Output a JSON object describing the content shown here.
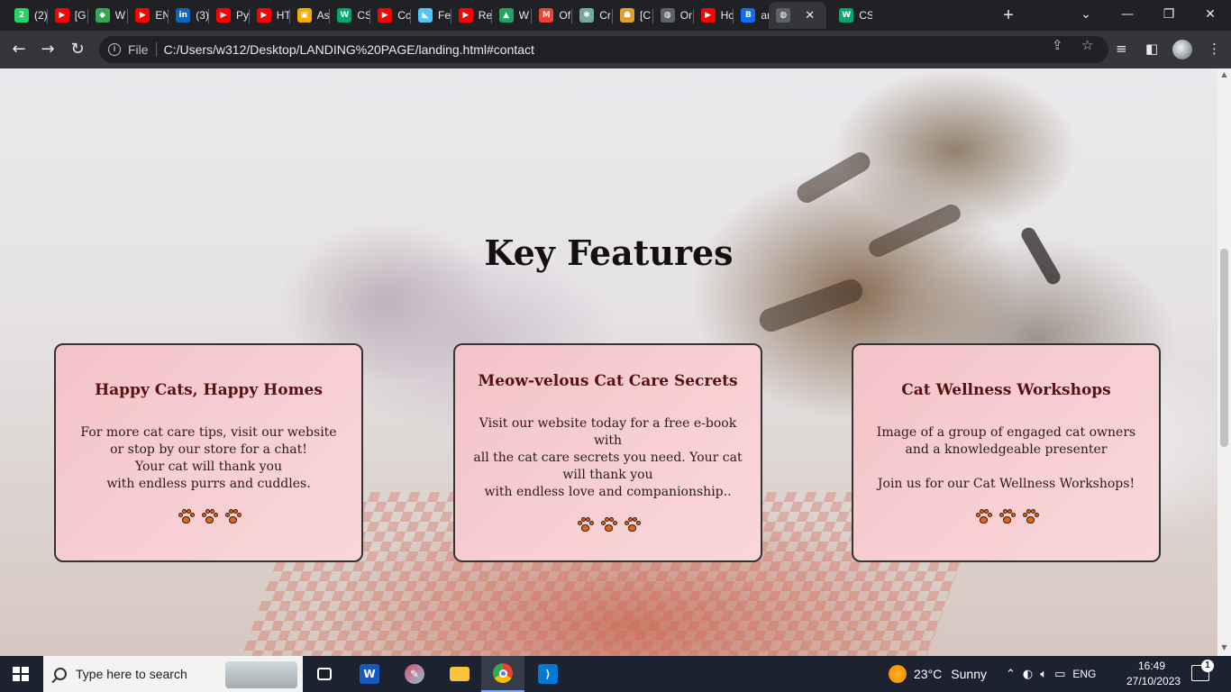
{
  "browser": {
    "tabs": [
      {
        "label": "(2)",
        "icon": "whatsapp-icon",
        "color": "#25d366",
        "glyph": "2"
      },
      {
        "label": "[G",
        "icon": "youtube-icon",
        "color": "#ff0000",
        "glyph": "▶"
      },
      {
        "label": "W",
        "icon": "maps-icon",
        "color": "#34a853",
        "glyph": "◆"
      },
      {
        "label": "EN",
        "icon": "youtube-icon",
        "color": "#ff0000",
        "glyph": "▶"
      },
      {
        "label": "(3)",
        "icon": "linkedin-icon",
        "color": "#0a66c2",
        "glyph": "in"
      },
      {
        "label": "Py",
        "icon": "youtube-icon",
        "color": "#ff0000",
        "glyph": "▶"
      },
      {
        "label": "HT",
        "icon": "youtube-icon",
        "color": "#ff0000",
        "glyph": "▶"
      },
      {
        "label": "As",
        "icon": "classroom-icon",
        "color": "#f9ab00",
        "glyph": "▣"
      },
      {
        "label": "CS",
        "icon": "w3schools-icon",
        "color": "#04aa6d",
        "glyph": "W"
      },
      {
        "label": "Cc",
        "icon": "youtube-icon",
        "color": "#ff0000",
        "glyph": "▶"
      },
      {
        "label": "Fe",
        "icon": "flutter-icon",
        "color": "#54c5f8",
        "glyph": "◣"
      },
      {
        "label": "Re",
        "icon": "youtube-icon",
        "color": "#ff0000",
        "glyph": "▶"
      },
      {
        "label": "W",
        "icon": "drive-icon",
        "color": "#1fa463",
        "glyph": "▲"
      },
      {
        "label": "Of",
        "icon": "gmail-icon",
        "color": "#ea4335",
        "glyph": "M"
      },
      {
        "label": "Cr",
        "icon": "chatgpt-icon",
        "color": "#74aa9c",
        "glyph": "✱"
      },
      {
        "label": "[C",
        "icon": "badge-icon",
        "color": "#e0a030",
        "glyph": "☗"
      },
      {
        "label": "Or",
        "icon": "globe-icon",
        "color": "#5f6368",
        "glyph": "◍"
      },
      {
        "label": "Hc",
        "icon": "youtube-icon",
        "color": "#ff0000",
        "glyph": "▶"
      },
      {
        "label": "ar",
        "icon": "bootstrap-icon",
        "color": "#0d6efd",
        "glyph": "B"
      },
      {
        "label": "",
        "icon": "globe-icon",
        "color": "#5f6368",
        "glyph": "◍",
        "active": true
      },
      {
        "label": "CS",
        "icon": "w3schools-icon",
        "color": "#04aa6d",
        "glyph": "W"
      }
    ],
    "address": {
      "scheme_label": "File",
      "url": "C:/Users/w312/Desktop/LANDING%20PAGE/landing.html#contact"
    }
  },
  "page": {
    "heading": "Key Features",
    "cards": [
      {
        "title": "Happy Cats, Happy Homes",
        "lines": [
          "For more cat care tips, visit our website or stop by our store for a chat!",
          "Your cat will thank you",
          "with endless purrs and cuddles."
        ]
      },
      {
        "title": "Meow-velous Cat Care Secrets",
        "lines": [
          "Visit our website today for a free e-book with",
          "all the cat care secrets you need. Your cat will thank you",
          "with endless love and companionship.."
        ]
      },
      {
        "title": "Cat Wellness Workshops",
        "lines": [
          "Image of a group of engaged cat owners and a knowledgeable presenter",
          "",
          "Join us for our Cat Wellness Workshops!"
        ]
      }
    ],
    "paw_icon": "paw-print-icon",
    "paw_count": 3
  },
  "taskbar": {
    "search_placeholder": "Type here to search",
    "apps": [
      "task-view-icon",
      "word-icon",
      "paint-icon",
      "file-explorer-icon",
      "chrome-icon",
      "vscode-icon"
    ],
    "weather_temp": "23°C",
    "weather_text": "Sunny",
    "language": "ENG",
    "time": "16:49",
    "date": "27/10/2023",
    "notifications": "1"
  }
}
